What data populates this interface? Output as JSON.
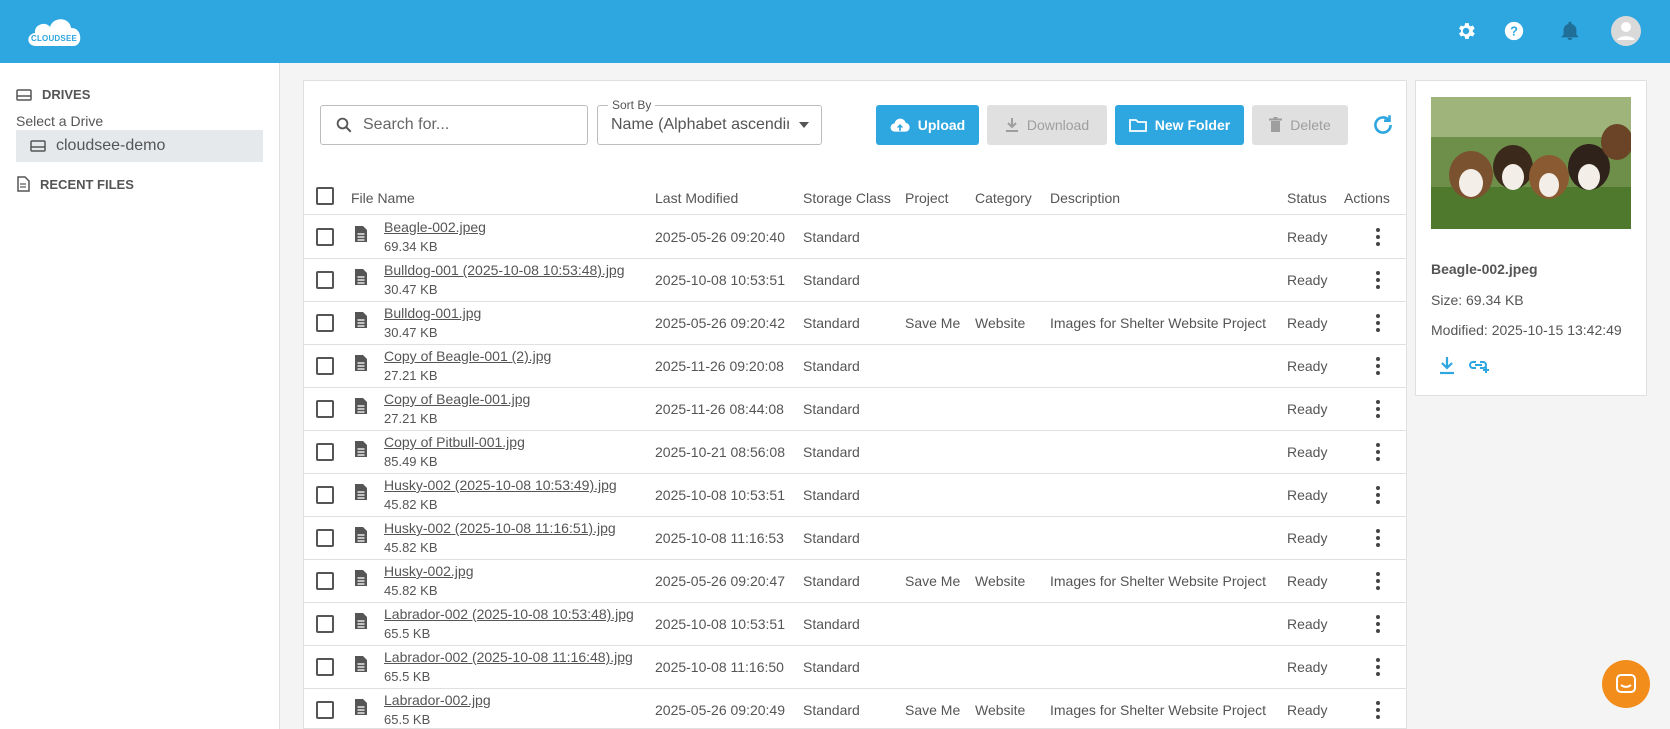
{
  "header": {
    "logo_text": "CLOUDSEE",
    "icons": [
      "settings-icon",
      "help-icon",
      "notifications-icon",
      "account-icon"
    ],
    "color": "#2ea6e0"
  },
  "sidebar": {
    "drives_heading": "DRIVES",
    "select_label": "Select a Drive",
    "drive_name": "cloudsee-demo",
    "recent_heading": "RECENT FILES"
  },
  "toolbar": {
    "search_placeholder": "Search for...",
    "sort_label": "Sort By",
    "sort_value": "Name (Alphabet ascending)",
    "upload": "Upload",
    "download": "Download",
    "new_folder": "New Folder",
    "delete": "Delete"
  },
  "table": {
    "columns": {
      "file_name": "File Name",
      "last_modified": "Last Modified",
      "storage_class": "Storage Class",
      "project": "Project",
      "category": "Category",
      "description": "Description",
      "status": "Status",
      "actions": "Actions"
    },
    "rows": [
      {
        "name": "Beagle-002.jpeg",
        "size": "69.34 KB",
        "modified": "2025-05-26 09:20:40",
        "storage": "Standard",
        "project": "",
        "category": "",
        "description": "",
        "status": "Ready"
      },
      {
        "name": "Bulldog-001 (2025-10-08 10:53:48).jpg",
        "size": "30.47 KB",
        "modified": "2025-10-08 10:53:51",
        "storage": "Standard",
        "project": "",
        "category": "",
        "description": "",
        "status": "Ready"
      },
      {
        "name": "Bulldog-001.jpg",
        "size": "30.47 KB",
        "modified": "2025-05-26 09:20:42",
        "storage": "Standard",
        "project": "Save Me",
        "category": "Website",
        "description": "Images for Shelter Website Project",
        "status": "Ready"
      },
      {
        "name": "Copy of Beagle-001 (2).jpg",
        "size": "27.21 KB",
        "modified": "2025-11-26 09:20:08",
        "storage": "Standard",
        "project": "",
        "category": "",
        "description": "",
        "status": "Ready"
      },
      {
        "name": "Copy of Beagle-001.jpg",
        "size": "27.21 KB",
        "modified": "2025-11-26 08:44:08",
        "storage": "Standard",
        "project": "",
        "category": "",
        "description": "",
        "status": "Ready"
      },
      {
        "name": "Copy of Pitbull-001.jpg",
        "size": "85.49 KB",
        "modified": "2025-10-21 08:56:08",
        "storage": "Standard",
        "project": "",
        "category": "",
        "description": "",
        "status": "Ready"
      },
      {
        "name": "Husky-002 (2025-10-08 10:53:49).jpg",
        "size": "45.82 KB",
        "modified": "2025-10-08 10:53:51",
        "storage": "Standard",
        "project": "",
        "category": "",
        "description": "",
        "status": "Ready"
      },
      {
        "name": "Husky-002 (2025-10-08 11:16:51).jpg",
        "size": "45.82 KB",
        "modified": "2025-10-08 11:16:53",
        "storage": "Standard",
        "project": "",
        "category": "",
        "description": "",
        "status": "Ready"
      },
      {
        "name": "Husky-002.jpg",
        "size": "45.82 KB",
        "modified": "2025-05-26 09:20:47",
        "storage": "Standard",
        "project": "Save Me",
        "category": "Website",
        "description": "Images for Shelter Website Project",
        "status": "Ready"
      },
      {
        "name": "Labrador-002 (2025-10-08 10:53:48).jpg",
        "size": "65.5 KB",
        "modified": "2025-10-08 10:53:51",
        "storage": "Standard",
        "project": "",
        "category": "",
        "description": "",
        "status": "Ready"
      },
      {
        "name": "Labrador-002 (2025-10-08 11:16:48).jpg",
        "size": "65.5 KB",
        "modified": "2025-10-08 11:16:50",
        "storage": "Standard",
        "project": "",
        "category": "",
        "description": "",
        "status": "Ready"
      },
      {
        "name": "Labrador-002.jpg",
        "size": "65.5 KB",
        "modified": "2025-05-26 09:20:49",
        "storage": "Standard",
        "project": "Save Me",
        "category": "Website",
        "description": "Images for Shelter Website Project",
        "status": "Ready"
      }
    ]
  },
  "preview": {
    "name": "Beagle-002.jpeg",
    "size": "Size: 69.34 KB",
    "modified": "Modified: 2025-10-15 13:42:49",
    "actions": [
      "download-icon",
      "share-link-icon"
    ]
  },
  "chat": {
    "icon": "chat-icon",
    "color": "#f28c1b"
  }
}
